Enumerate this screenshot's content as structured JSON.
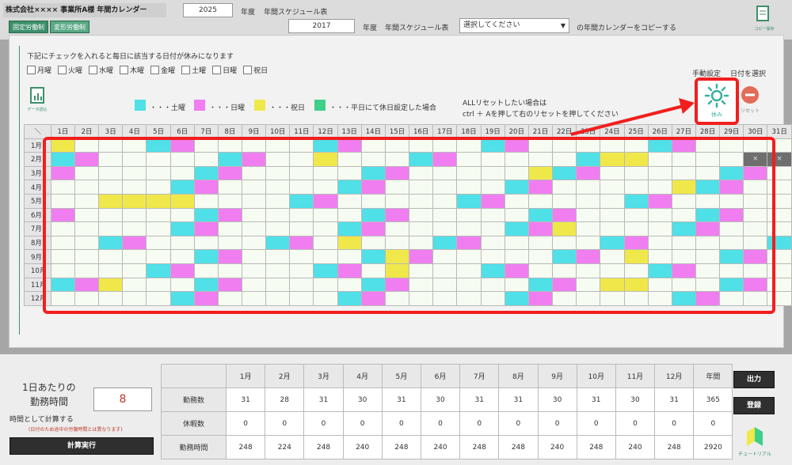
{
  "header": {
    "company": "株式会社×××× 事業所A様 年間カレンダー",
    "year": "2025",
    "year_unit": "年度",
    "schedule_title": "年間スケジュール表",
    "copy_year": "2017",
    "copy_year_unit": "年度",
    "copy_schedule_title": "年間スケジュール表",
    "select_placeholder": "選択してください",
    "copy_suffix": "の年間カレンダーをコピーする",
    "tab_fixed": "固定労働制",
    "tab_variable": "変形労働制",
    "icon_right_label": "コピー保存"
  },
  "panel": {
    "instruction": "下記にチェックを入れると毎日に該当する日付が休みになります",
    "weekdays": [
      "月曜",
      "火曜",
      "水曜",
      "木曜",
      "金曜",
      "土曜",
      "日曜",
      "祝日"
    ],
    "manual_label": "手動設定",
    "select_date_label": "日付を選択",
    "data_read_label": "データ読込",
    "legend": [
      {
        "color": "#4fe0e8",
        "label": "・・・土曜"
      },
      {
        "color": "#f07ef0",
        "label": "・・・日曜"
      },
      {
        "color": "#f0e84a",
        "label": "・・・祝日"
      },
      {
        "color": "#3ecf8a",
        "label": "・・・平日にて休日設定した場合"
      }
    ],
    "reset_line1": "ALLリセットしたい場合は",
    "reset_line2": "ctrl ＋ Aを押して右のリセットを押してください",
    "holiday_btn_label": "休み",
    "reset_btn_label": "リセット",
    "colors": {
      "saturday": "#4fe0e8",
      "sunday": "#f07ef0",
      "holiday": "#f0e84a",
      "invalid": "#6e6e6e"
    }
  },
  "calendar": {
    "corner": "＼",
    "days": [
      "1日",
      "2日",
      "3日",
      "4日",
      "5日",
      "6日",
      "7日",
      "8日",
      "9日",
      "10日",
      "11日",
      "12日",
      "13日",
      "14日",
      "15日",
      "16日",
      "17日",
      "18日",
      "19日",
      "20日",
      "21日",
      "22日",
      "23日",
      "24日",
      "25日",
      "26日",
      "27日",
      "28日",
      "29日",
      "30日",
      "31日"
    ],
    "months": [
      "1月",
      "2月",
      "3月",
      "4月",
      "5月",
      "6月",
      "7月",
      "8月",
      "9月",
      "10月",
      "11月",
      "12月"
    ],
    "rows": [
      "h...su.....su.....su.....su...",
      "su.....su..h...su.....shh....xxx",
      "u.....su.....su.....hsu.....su.",
      ".....su.....su.....su.....hsu..x",
      "..hhhh....su.....su.....su.....s",
      "u.....su.....su.....su.....su..x",
      ".....su.....su.....suh....su...",
      "..su.....su.h...su.....su.....su",
      "......su.....shu.....su.h...su..x",
      "....su.....su.h...su.....su.....",
      "sgh...su.....su.....su.hh...su..x",
      ".....su.....su.....su.....su....."
    ],
    "invalid_mark": "×"
  },
  "summary": {
    "months": [
      "1月",
      "2月",
      "3月",
      "4月",
      "5月",
      "6月",
      "7月",
      "8月",
      "9月",
      "10月",
      "11月",
      "12月",
      "年間"
    ],
    "work_days_label": "勤務数",
    "holidays_label": "休暇数",
    "work_hours_label": "勤務時間",
    "work_days": [
      "31",
      "28",
      "31",
      "30",
      "31",
      "30",
      "31",
      "31",
      "30",
      "31",
      "30",
      "31",
      "365"
    ],
    "holidays": [
      "0",
      "0",
      "0",
      "0",
      "0",
      "0",
      "0",
      "0",
      "0",
      "0",
      "0",
      "0",
      "0"
    ],
    "work_hours": [
      "248",
      "224",
      "248",
      "240",
      "248",
      "240",
      "248",
      "248",
      "240",
      "248",
      "240",
      "248",
      "2920"
    ]
  },
  "left_calc": {
    "title1": "1日あたりの",
    "title2": "勤務時間",
    "hours": "8",
    "note1": "時間として計算する",
    "note2": "(日付のため途中の労働時間とは異なります)",
    "run": "計算実行"
  },
  "right_buttons": {
    "output": "出力",
    "register": "登録",
    "tutorial": "チュートリアル"
  }
}
